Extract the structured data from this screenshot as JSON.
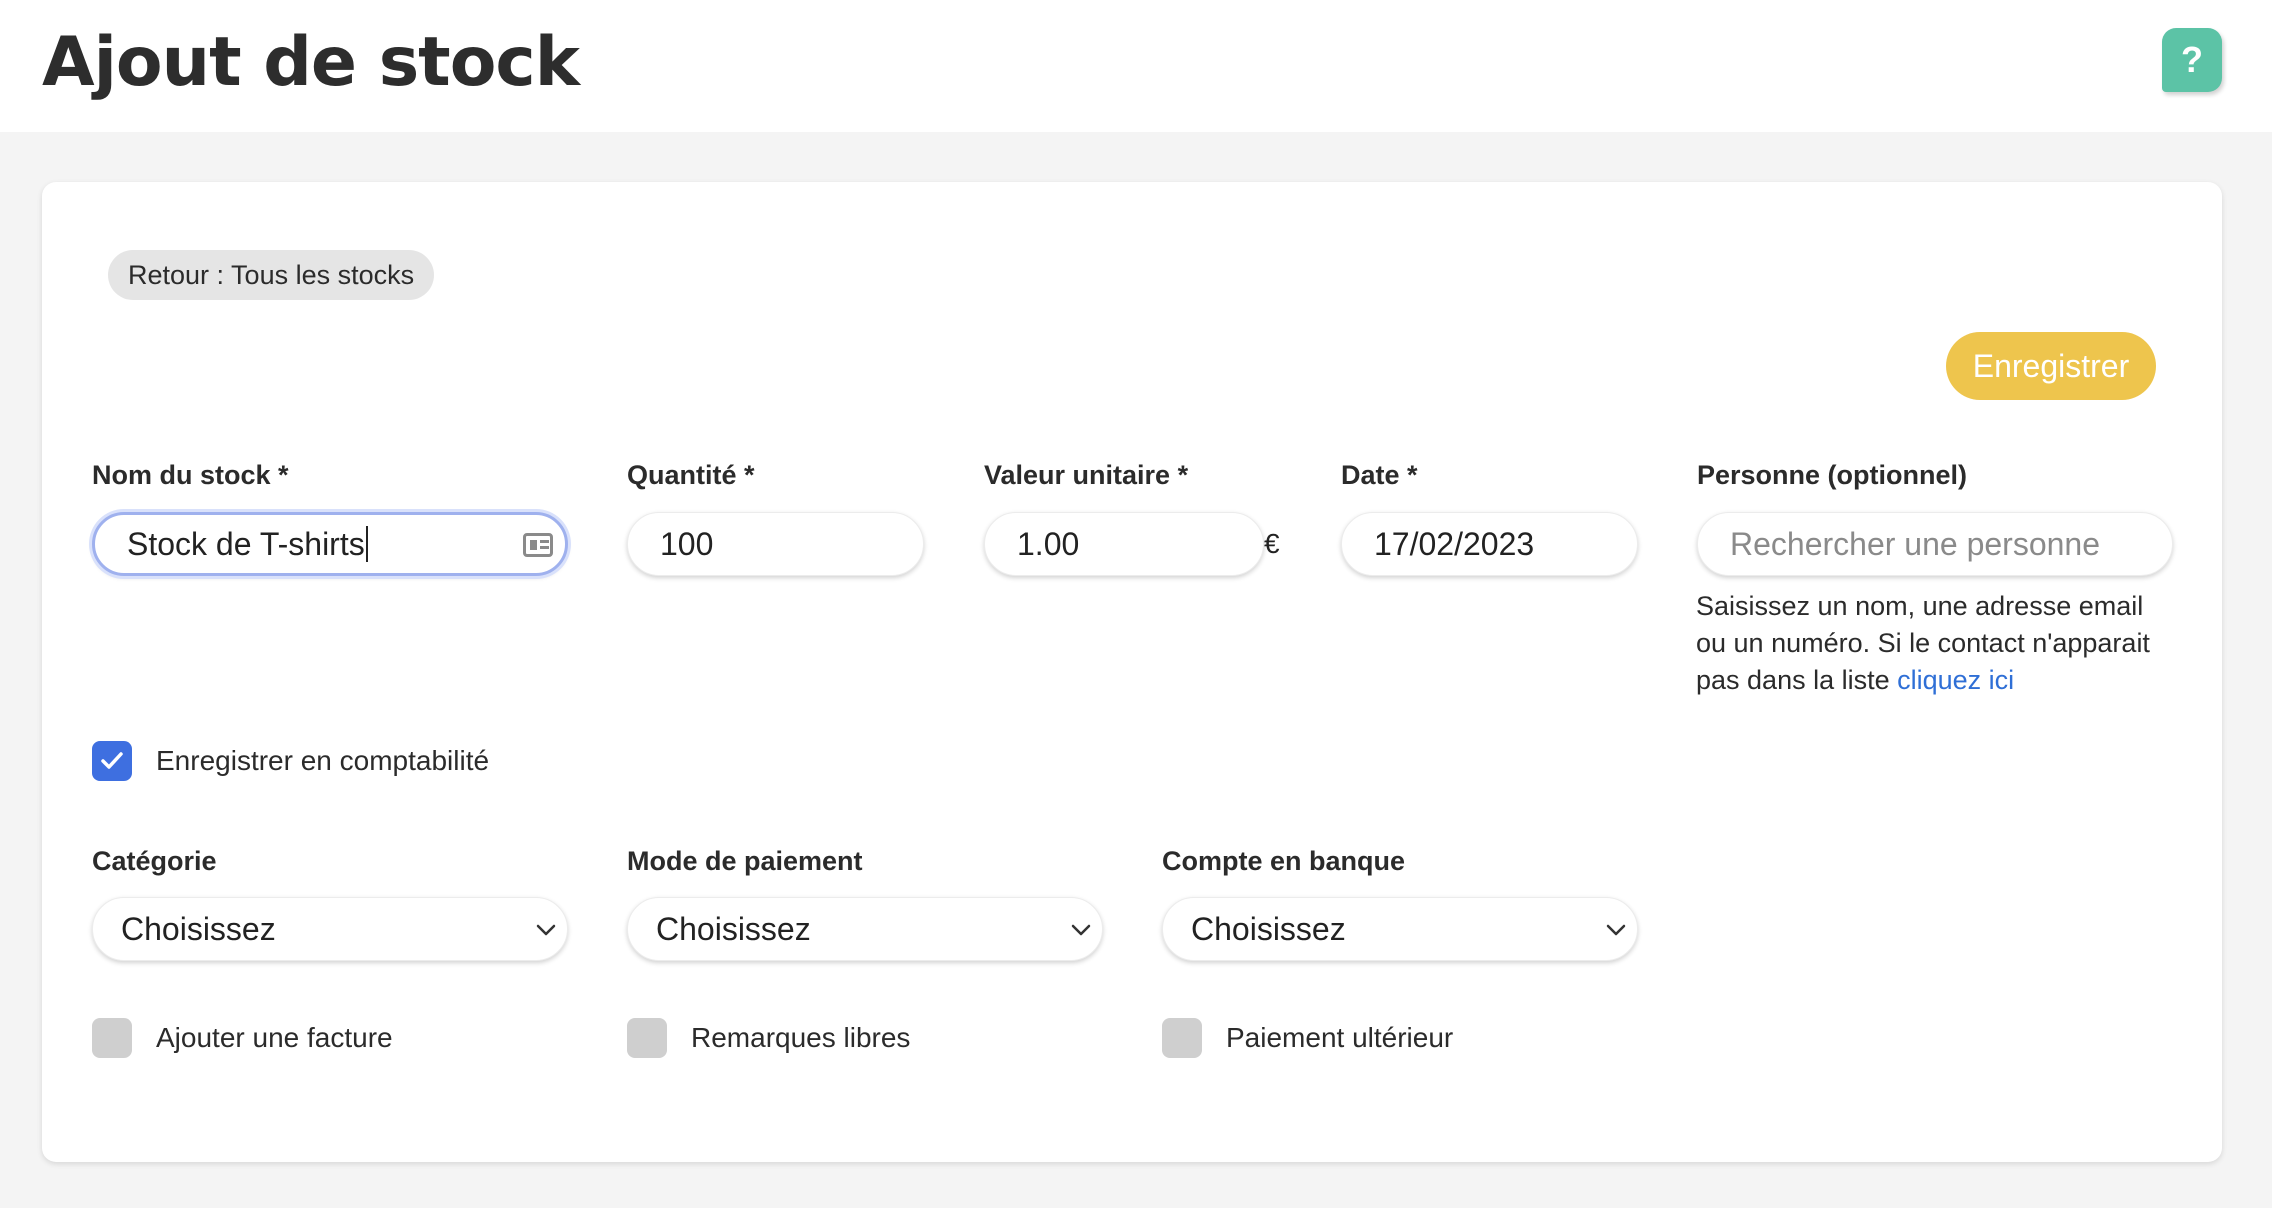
{
  "header": {
    "title": "Ajout de stock",
    "help_label": "?"
  },
  "toolbar": {
    "back_label": "Retour : Tous les stocks",
    "save_label": "Enregistrer"
  },
  "form": {
    "stock_name": {
      "label": "Nom du stock *",
      "value": "Stock de T-shirts"
    },
    "quantity": {
      "label": "Quantité *",
      "value": "100"
    },
    "unit_value": {
      "label": "Valeur unitaire *",
      "value": "1.00",
      "currency": "€"
    },
    "date": {
      "label": "Date *",
      "value": "17/02/2023"
    },
    "person": {
      "label": "Personne (optionnel)",
      "placeholder": "Rechercher une personne",
      "help_line1": "Saisissez un nom, une adresse email",
      "help_line2": "ou un numéro. Si le contact n'apparait",
      "help_line3": "pas dans la liste ",
      "help_link": "cliquez ici"
    },
    "accounting": {
      "label": "Enregistrer en comptabilité",
      "checked": true
    },
    "category": {
      "label": "Catégorie",
      "value": "Choisissez"
    },
    "payment_mode": {
      "label": "Mode de paiement",
      "value": "Choisissez"
    },
    "bank_account": {
      "label": "Compte en banque",
      "value": "Choisissez"
    },
    "options": {
      "invoice": {
        "label": "Ajouter une facture",
        "checked": false
      },
      "remarks": {
        "label": "Remarques libres",
        "checked": false
      },
      "later_payment": {
        "label": "Paiement ultérieur",
        "checked": false
      }
    }
  },
  "colors": {
    "accent": "#eec54d",
    "help": "#5cc3a6",
    "checkbox_checked": "#3e6fe0",
    "link": "#2f6fd6"
  }
}
